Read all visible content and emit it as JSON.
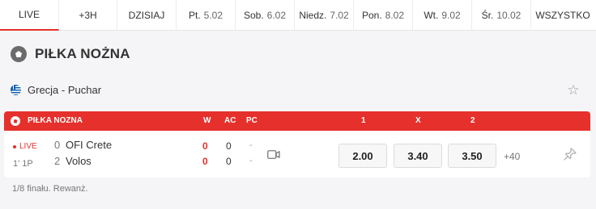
{
  "tabs": [
    {
      "label": "LIVE",
      "date": ""
    },
    {
      "label": "+3H",
      "date": ""
    },
    {
      "label": "DZISIAJ",
      "date": ""
    },
    {
      "label": "Pt.",
      "date": "5.02"
    },
    {
      "label": "Sob.",
      "date": "6.02"
    },
    {
      "label": "Niedz.",
      "date": "7.02"
    },
    {
      "label": "Pon.",
      "date": "8.02"
    },
    {
      "label": "Wt.",
      "date": "9.02"
    },
    {
      "label": "Śr.",
      "date": "10.02"
    },
    {
      "label": "WSZYSTKO",
      "date": ""
    }
  ],
  "sport": {
    "title": "PIŁKA NOŻNA",
    "icon": "soccer-ball-icon"
  },
  "league": {
    "name": "Grecja - Puchar",
    "flag": "greece-flag-icon"
  },
  "table_header": {
    "sport": "PIŁKA NOZNA",
    "w": "W",
    "ac": "AC",
    "pc": "PC",
    "o1": "1",
    "ox": "X",
    "o2": "2"
  },
  "match": {
    "live": "LIVE",
    "time": "1' 1P",
    "home": {
      "name": "OFI Crete",
      "score": "0",
      "w": "0",
      "ac": "0",
      "pc": "-"
    },
    "away": {
      "name": "Volos",
      "score": "2",
      "w": "0",
      "ac": "0",
      "pc": "-"
    },
    "odds": {
      "o1": "2.00",
      "ox": "3.40",
      "o2": "3.50"
    },
    "more": "+40"
  },
  "note": "1/8 finału. Rewanż.",
  "colors": {
    "accent": "#e5302b",
    "background": "#f5f5f7"
  }
}
